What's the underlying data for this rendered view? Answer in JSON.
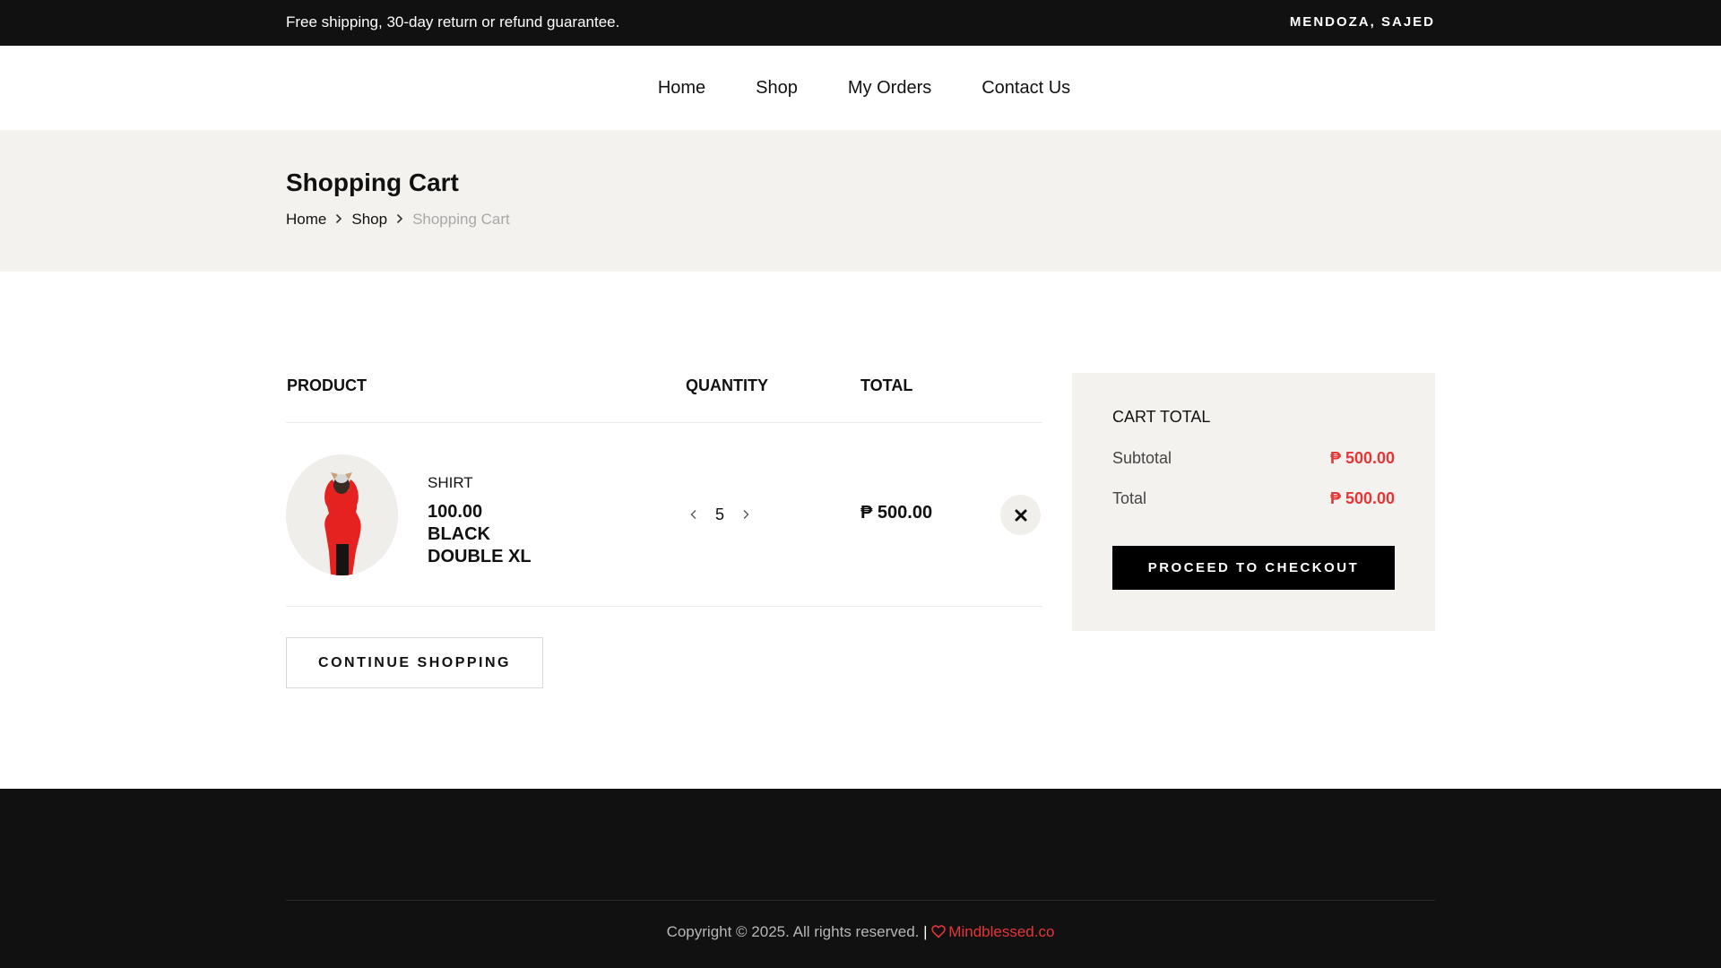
{
  "topbar": {
    "notice": "Free shipping, 30-day return or refund guarantee.",
    "user": "MENDOZA, SAJED"
  },
  "nav": {
    "items": [
      "Home",
      "Shop",
      "My Orders",
      "Contact Us"
    ]
  },
  "hero": {
    "title": "Shopping Cart",
    "breadcrumb": [
      "Home",
      "Shop",
      "Shopping Cart"
    ]
  },
  "cart": {
    "headers": {
      "product": "PRODUCT",
      "quantity": "QUANTITY",
      "total": "TOTAL"
    },
    "items": [
      {
        "category": "SHIRT",
        "price_line": "100.00",
        "color_line": "BLACK",
        "size_line": "DOUBLE XL",
        "quantity": "5",
        "total": "₱ 500.00",
        "prev_icon": "chevron-left-icon",
        "next_icon": "chevron-right-icon",
        "remove_icon": "close-icon"
      }
    ],
    "continue_label": "CONTINUE SHOPPING"
  },
  "summary": {
    "title": "CART TOTAL",
    "subtotal_label": "Subtotal",
    "subtotal_value": "₱ 500.00",
    "total_label": "Total",
    "total_value": "₱ 500.00",
    "checkout_label": "PROCEED TO CHECKOUT"
  },
  "footer": {
    "copyright": "Copyright © 2025. All rights reserved. ",
    "separator": "|",
    "brand": "Mindblessed.co",
    "brand_icon": "heart-icon"
  },
  "colors": {
    "dark": "#111111",
    "accent_red": "#e53637",
    "light_bg": "#f3f2ee"
  }
}
